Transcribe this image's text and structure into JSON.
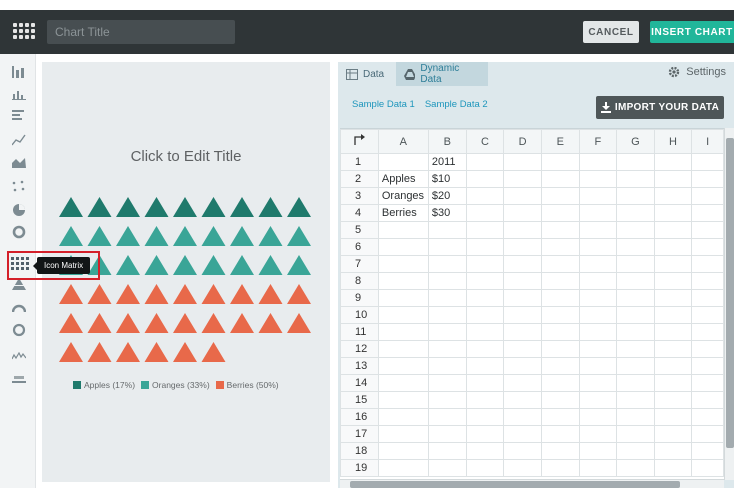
{
  "header": {
    "title_placeholder": "Chart Title",
    "cancel_label": "CANCEL",
    "insert_label": "INSERT CHART"
  },
  "toolbar": {
    "tools": [
      "bar-chart-icon",
      "column-chart-icon",
      "horizontal-bar-icon",
      "line-chart-icon",
      "area-chart-icon",
      "scatter-icon",
      "pie-chart-icon",
      "donut-chart-icon",
      "icon-matrix-icon",
      "pyramid-icon",
      "gauge-icon",
      "ring-icon",
      "sparkline-icon",
      "percent-icon"
    ],
    "tooltip": "Icon Matrix"
  },
  "preview": {
    "title": "Click to Edit Title",
    "matrix": {
      "rows": 6,
      "cols": 9,
      "last_row_count": 6,
      "counts": {
        "Apples": 9,
        "Oranges": 18,
        "Berries": 24
      },
      "colors": {
        "Apples": "#1f7a6c",
        "Oranges": "#3aa597",
        "Berries": "#e8694a"
      }
    },
    "legend": [
      {
        "label": "Apples (17%)",
        "color": "#1f7a6c"
      },
      {
        "label": "Oranges (33%)",
        "color": "#3aa597"
      },
      {
        "label": "Berries (50%)",
        "color": "#e8694a"
      }
    ]
  },
  "data_panel": {
    "tab_data": "Data",
    "tab_dynamic": "Dynamic Data",
    "settings_label": "Settings",
    "sample_1": "Sample Data 1",
    "sample_2": "Sample Data 2",
    "import_label": "IMPORT YOUR DATA",
    "columns": [
      "A",
      "B",
      "C",
      "D",
      "E",
      "F",
      "G",
      "H",
      "I"
    ],
    "rows": [
      {
        "n": "1",
        "cells": [
          "",
          "2011"
        ]
      },
      {
        "n": "2",
        "cells": [
          "Apples",
          "$10"
        ]
      },
      {
        "n": "3",
        "cells": [
          "Oranges",
          "$20"
        ]
      },
      {
        "n": "4",
        "cells": [
          "Berries",
          "$30"
        ]
      },
      {
        "n": "5",
        "cells": []
      },
      {
        "n": "6",
        "cells": []
      },
      {
        "n": "7",
        "cells": []
      },
      {
        "n": "8",
        "cells": []
      },
      {
        "n": "9",
        "cells": []
      },
      {
        "n": "10",
        "cells": []
      },
      {
        "n": "11",
        "cells": []
      },
      {
        "n": "12",
        "cells": []
      },
      {
        "n": "13",
        "cells": []
      },
      {
        "n": "14",
        "cells": []
      },
      {
        "n": "15",
        "cells": []
      },
      {
        "n": "16",
        "cells": []
      },
      {
        "n": "17",
        "cells": []
      },
      {
        "n": "18",
        "cells": []
      },
      {
        "n": "19",
        "cells": []
      }
    ]
  }
}
